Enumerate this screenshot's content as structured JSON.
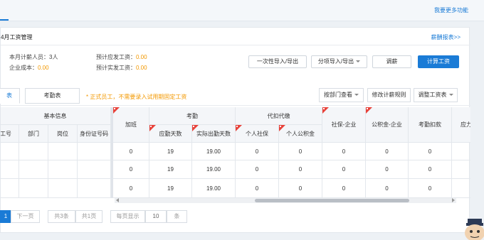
{
  "header": {
    "more_link": "我要更多功能"
  },
  "card": {
    "title": "4月工资管理",
    "report_link": "薪酬报表>>",
    "summary": {
      "count_label": "本月计薪人员：3人",
      "cost_label": "企业成本：",
      "cost_value": "0.00",
      "expected_label": "预计应发工资：",
      "expected_value": "0.00",
      "actual_label": "预计实发工资：",
      "actual_value": "0.00"
    },
    "buttons": {
      "import_once": "一次性导入/导出",
      "import_item": "分项导入/导出",
      "adjust": "调薪",
      "calculate": "计算工资"
    }
  },
  "tabs": {
    "salary": "表",
    "attendance": "考勤表",
    "notice": "* 正式员工，不需要录入试用期固定工资",
    "by_dept": "按部门查看",
    "modify_rule": "修改计薪规则",
    "adjust_table": "调整工资表"
  },
  "table": {
    "group_basic": "基本信息",
    "col_id": "工号",
    "col_dept": "部门",
    "col_post": "岗位",
    "col_idcard": "身份证号码",
    "col_overtime": "加班",
    "group_attendance": "考勤",
    "col_due_days": "应勤天数",
    "col_actual_days": "实际出勤天数",
    "group_deduct": "代扣代缴",
    "col_social_personal": "个人社保",
    "col_fund_personal": "个人公积金",
    "col_social_company": "社保-企业",
    "col_fund_company": "公积金-企业",
    "col_attend_deduct": "考勤扣款",
    "col_last": "应力",
    "rows": [
      {
        "overtime": "0",
        "due_days": "19",
        "actual_days": "19.00",
        "social_personal": "0",
        "fund_personal": "0",
        "social_company": "0",
        "fund_company": "0",
        "attend_deduct": "0"
      },
      {
        "overtime": "0",
        "due_days": "19",
        "actual_days": "19.00",
        "social_personal": "0",
        "fund_personal": "0",
        "social_company": "0",
        "fund_company": "0",
        "attend_deduct": "0"
      },
      {
        "overtime": "0",
        "due_days": "19",
        "actual_days": "19.00",
        "social_personal": "0",
        "fund_personal": "0",
        "social_company": "0",
        "fund_company": "0",
        "attend_deduct": "0"
      }
    ]
  },
  "pagination": {
    "current": "1",
    "next": "下一页",
    "total_items": "共3条",
    "total_pages": "共1页",
    "per_page_label": "每页显示",
    "per_page_value": "10",
    "unit": "条"
  },
  "colors": {
    "accent": "#1a7bd6",
    "warning": "#f39800",
    "marker": "#e8423a"
  }
}
